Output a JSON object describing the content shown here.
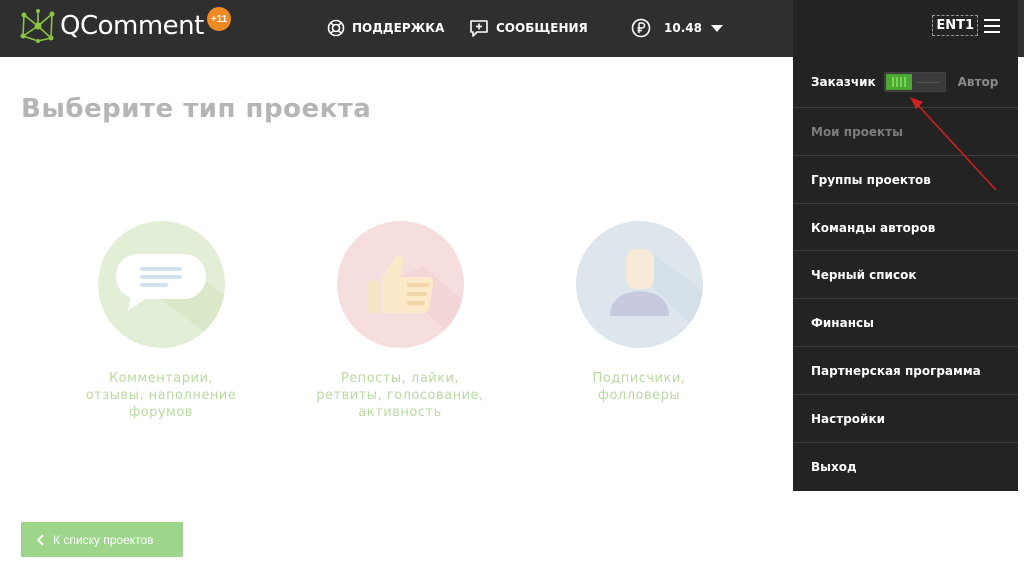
{
  "header": {
    "logo_text": "QComment",
    "logo_badge": "+11",
    "support_label": "ПОДДЕРЖКА",
    "messages_label": "СООБЩЕНИЯ",
    "balance_value": "10.48",
    "currency_icon": "ruble-icon"
  },
  "user_menu": {
    "username": "ENT1",
    "role_left": "Заказчик",
    "role_right": "Автор",
    "role_toggle_state": "Заказчик",
    "items": [
      {
        "label": "Мои проекты",
        "muted": true
      },
      {
        "label": "Группы проектов",
        "muted": false
      },
      {
        "label": "Команды авторов",
        "muted": false
      },
      {
        "label": "Черный список",
        "muted": false
      },
      {
        "label": "Финансы",
        "muted": false
      },
      {
        "label": "Партнерская программа",
        "muted": false
      },
      {
        "label": "Настройки",
        "muted": false
      },
      {
        "label": "Выход",
        "muted": false
      }
    ]
  },
  "main": {
    "title": "Выберите тип проекта",
    "project_types": [
      {
        "label_lines": [
          "Комментарии,",
          "отзывы, наполнение",
          "форумов"
        ],
        "icon": "speech-bubble-icon"
      },
      {
        "label_lines": [
          "Репосты, лайки,",
          "ретвиты, голосование,",
          "активность"
        ],
        "icon": "thumbs-up-icon"
      },
      {
        "label_lines": [
          "Подписчики,",
          "фолловеры"
        ],
        "icon": "person-icon"
      }
    ],
    "back_button_label": "К списку проектов"
  },
  "colors": {
    "topbar": "#2f2f2f",
    "dropdown": "#232323",
    "accent_green": "#4aa830",
    "logo_badge": "#f08a24",
    "back_button": "#9dd58a",
    "annotation_arrow": "#d02020"
  }
}
